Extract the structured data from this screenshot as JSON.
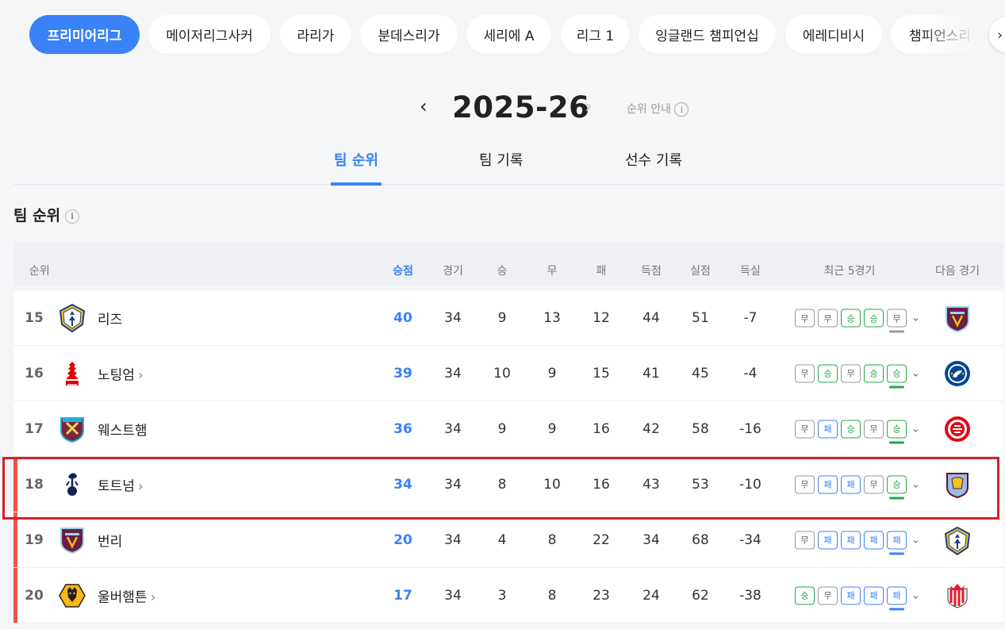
{
  "leagues": [
    {
      "label": "프리미어리그",
      "active": true
    },
    {
      "label": "메이저리그사커",
      "active": false
    },
    {
      "label": "라리가",
      "active": false
    },
    {
      "label": "분데스리가",
      "active": false
    },
    {
      "label": "세리에 A",
      "active": false
    },
    {
      "label": "리그 1",
      "active": false
    },
    {
      "label": "잉글랜드 챔피언십",
      "active": false
    },
    {
      "label": "에레디비시",
      "active": false
    },
    {
      "label": "챔피언스리그",
      "active": false
    }
  ],
  "season": {
    "prev": "‹",
    "title": "2025-26",
    "next": "›",
    "guide": "순위 안내",
    "info": "i"
  },
  "subtabs": [
    "팀 순위",
    "팀 기록",
    "선수 기록"
  ],
  "section_title": "팀 순위",
  "headers": {
    "rank": "순위",
    "pts": "승점",
    "played": "경기",
    "won": "승",
    "drawn": "무",
    "lost": "패",
    "gf": "득점",
    "ga": "실점",
    "gd": "득실",
    "form": "최근 5경기",
    "next": "다음 경기"
  },
  "rows": [
    {
      "rank": "15",
      "team": "리즈",
      "link": false,
      "pts": "40",
      "played": "34",
      "won": "9",
      "drawn": "13",
      "lost": "12",
      "gf": "44",
      "ga": "51",
      "gd": "-7",
      "form": [
        "무",
        "무",
        "승",
        "승",
        "무"
      ],
      "relegation": false,
      "crest": "leeds",
      "next_crest": "burnley"
    },
    {
      "rank": "16",
      "team": "노팅엄",
      "link": true,
      "pts": "39",
      "played": "34",
      "won": "10",
      "drawn": "9",
      "lost": "15",
      "gf": "41",
      "ga": "45",
      "gd": "-4",
      "form": [
        "무",
        "승",
        "무",
        "승",
        "승"
      ],
      "relegation": false,
      "crest": "forest",
      "next_crest": "chelsea"
    },
    {
      "rank": "17",
      "team": "웨스트햄",
      "link": false,
      "pts": "36",
      "played": "34",
      "won": "9",
      "drawn": "9",
      "lost": "16",
      "gf": "42",
      "ga": "58",
      "gd": "-16",
      "form": [
        "무",
        "패",
        "승",
        "무",
        "승"
      ],
      "relegation": false,
      "crest": "westham",
      "next_crest": "brentford"
    },
    {
      "rank": "18",
      "team": "토트넘",
      "link": true,
      "pts": "34",
      "played": "34",
      "won": "8",
      "drawn": "10",
      "lost": "16",
      "gf": "43",
      "ga": "53",
      "gd": "-10",
      "form": [
        "무",
        "패",
        "패",
        "무",
        "승"
      ],
      "relegation": true,
      "crest": "tottenham",
      "next_crest": "villa"
    },
    {
      "rank": "19",
      "team": "번리",
      "link": false,
      "pts": "20",
      "played": "34",
      "won": "4",
      "drawn": "8",
      "lost": "22",
      "gf": "34",
      "ga": "68",
      "gd": "-34",
      "form": [
        "무",
        "패",
        "패",
        "패",
        "패"
      ],
      "relegation": true,
      "crest": "burnley",
      "next_crest": "leeds"
    },
    {
      "rank": "20",
      "team": "울버햄튼",
      "link": true,
      "pts": "17",
      "played": "34",
      "won": "3",
      "drawn": "8",
      "lost": "23",
      "gf": "24",
      "ga": "62",
      "gd": "-38",
      "form": [
        "승",
        "무",
        "패",
        "패",
        "패"
      ],
      "relegation": true,
      "crest": "wolves",
      "next_crest": "sunderland"
    }
  ],
  "colors": {
    "accent": "#3a82f7",
    "win": "#22a845",
    "loss": "#3a82f7",
    "draw": "#999999",
    "relegation": "#f0524a",
    "highlight": "#d42128"
  }
}
